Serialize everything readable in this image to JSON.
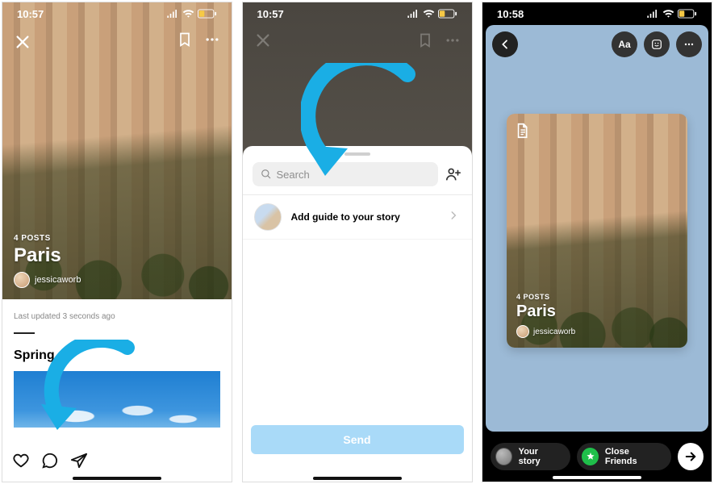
{
  "status": {
    "time_a": "10:57",
    "time_b": "10:58"
  },
  "guide": {
    "posts_label": "4 POSTS",
    "title": "Paris",
    "author": "jessicaworb",
    "last_updated": "Last updated 3 seconds ago",
    "section_title": "Spring sk"
  },
  "share_sheet": {
    "search_placeholder": "Search",
    "row_label": "Add guide to your story",
    "send_label": "Send"
  },
  "story_editor": {
    "text_btn": "Aa",
    "your_story": "Your story",
    "close_friends": "Close Friends"
  }
}
